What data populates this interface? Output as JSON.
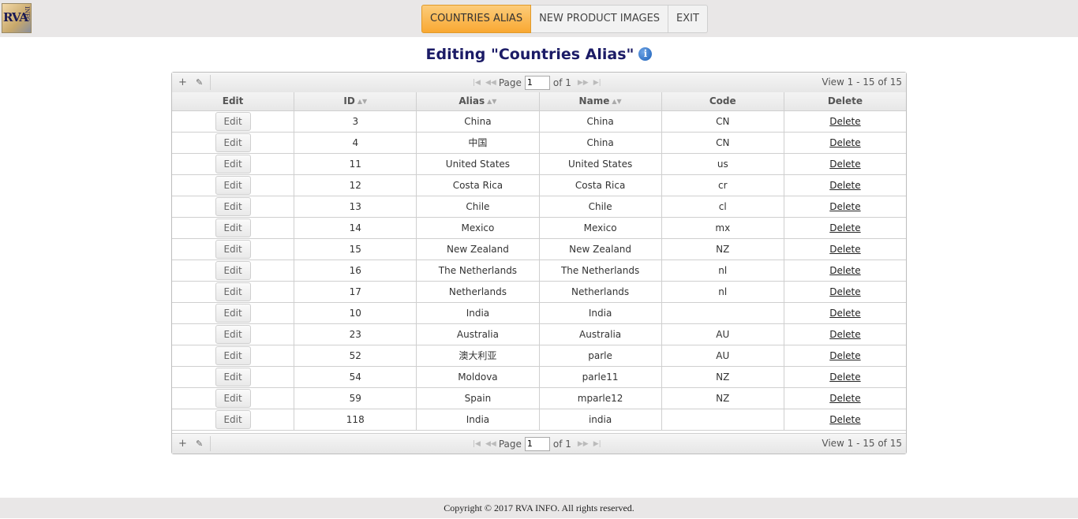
{
  "logo": {
    "text": "RVA",
    "sub": "INFO"
  },
  "nav": {
    "items": [
      {
        "label": "COUNTRIES ALIAS"
      },
      {
        "label": "NEW PRODUCT IMAGES"
      },
      {
        "label": "EXIT"
      }
    ]
  },
  "page": {
    "title": "Editing \"Countries Alias\"",
    "info_icon": "i"
  },
  "pager": {
    "page_label": "Page",
    "page_value": "1",
    "of_label": "of 1",
    "view_text": "View 1 - 15 of 15",
    "add_icon": "+",
    "edit_icon": "✎"
  },
  "table": {
    "headers": [
      "Edit",
      "ID",
      "Alias",
      "Name",
      "Code",
      "Delete"
    ],
    "edit_label": "Edit",
    "delete_label": "Delete",
    "rows": [
      {
        "id": "3",
        "alias": "China",
        "name": "China",
        "code": "CN"
      },
      {
        "id": "4",
        "alias": "中国",
        "name": "China",
        "code": "CN"
      },
      {
        "id": "11",
        "alias": "United States",
        "name": "United States",
        "code": "us"
      },
      {
        "id": "12",
        "alias": "Costa Rica",
        "name": "Costa Rica",
        "code": "cr"
      },
      {
        "id": "13",
        "alias": "Chile",
        "name": "Chile",
        "code": "cl"
      },
      {
        "id": "14",
        "alias": "Mexico",
        "name": "Mexico",
        "code": "mx"
      },
      {
        "id": "15",
        "alias": "New Zealand",
        "name": "New Zealand",
        "code": "NZ"
      },
      {
        "id": "16",
        "alias": "The Netherlands",
        "name": "The Netherlands",
        "code": "nl"
      },
      {
        "id": "17",
        "alias": "Netherlands",
        "name": "Netherlands",
        "code": "nl"
      },
      {
        "id": "10",
        "alias": "India",
        "name": "India",
        "code": ""
      },
      {
        "id": "23",
        "alias": "Australia",
        "name": "Australia",
        "code": "AU"
      },
      {
        "id": "52",
        "alias": "澳大利亚",
        "name": "parle",
        "code": "AU"
      },
      {
        "id": "54",
        "alias": "Moldova",
        "name": "parle11",
        "code": "NZ"
      },
      {
        "id": "59",
        "alias": "Spain",
        "name": "mparle12",
        "code": "NZ"
      },
      {
        "id": "118",
        "alias": "India",
        "name": "india",
        "code": ""
      }
    ]
  },
  "footer": {
    "text": "Copyright © 2017 RVA INFO. All rights reserved."
  }
}
